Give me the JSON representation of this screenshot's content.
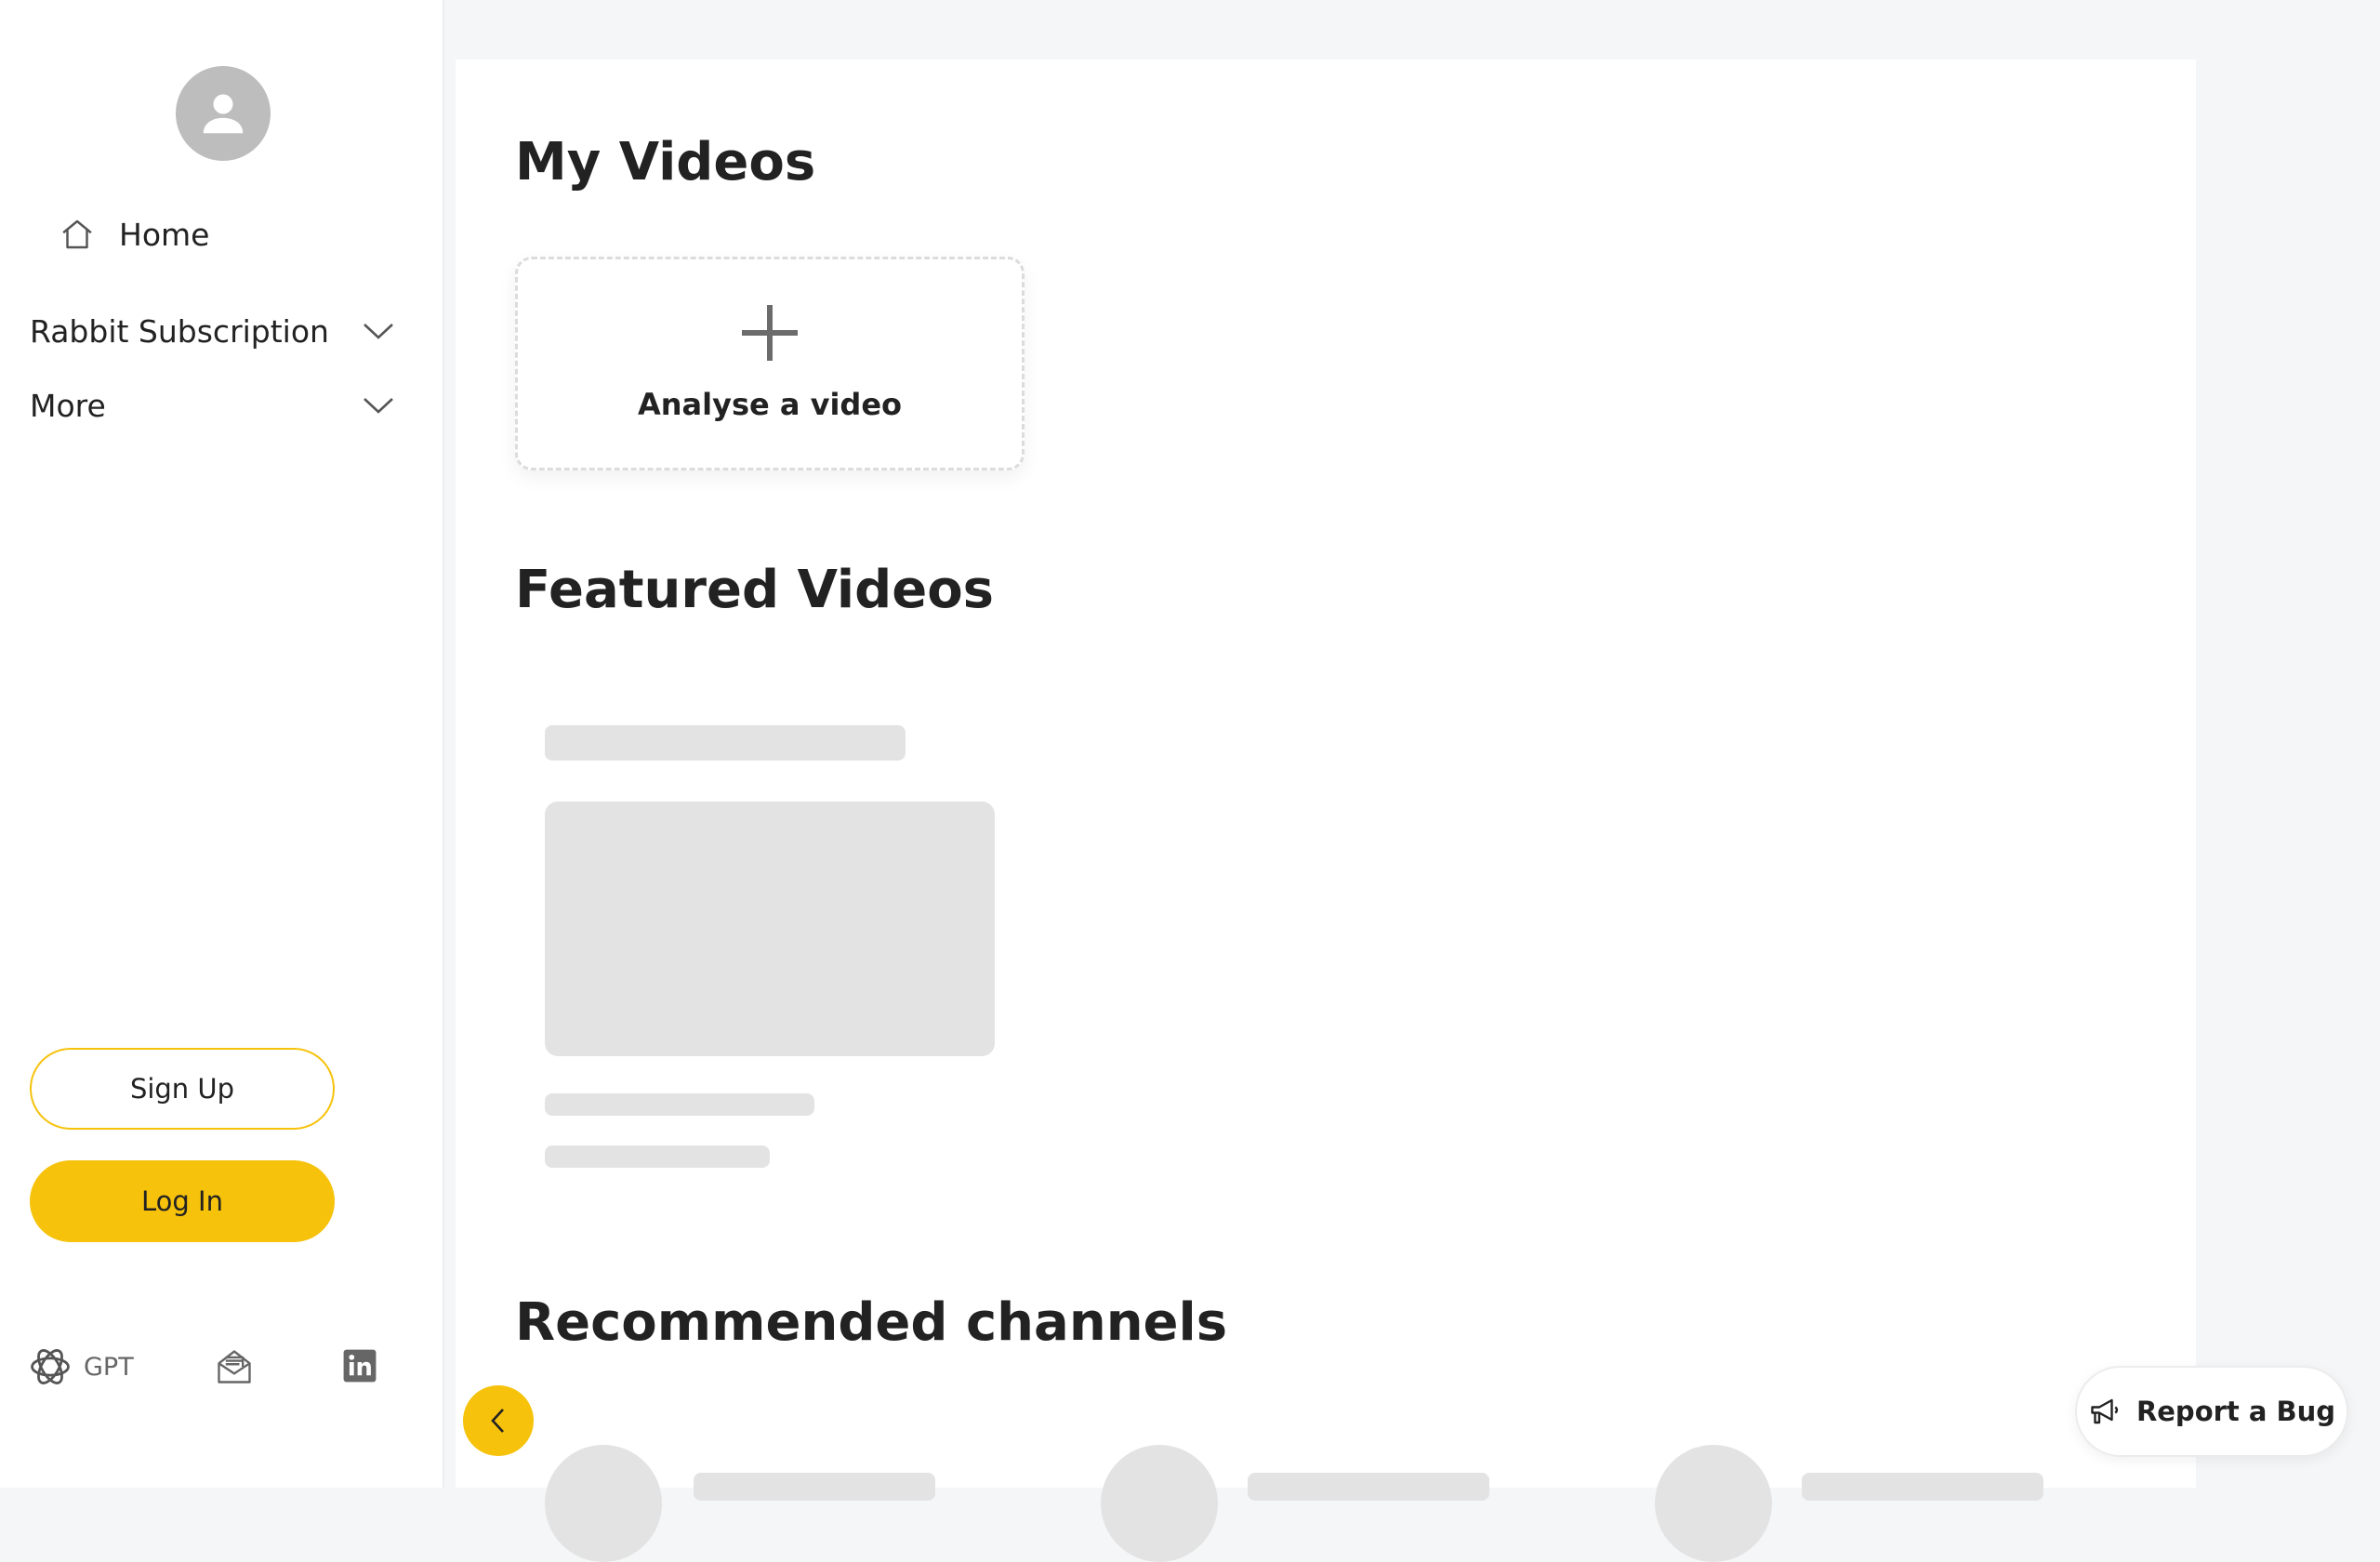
{
  "sidebar": {
    "avatar_icon": "user-avatar-icon",
    "home_label": "Home",
    "groups": [
      {
        "label": "Rabbit Subscription"
      },
      {
        "label": "More"
      }
    ],
    "signup_label": "Sign Up",
    "login_label": "Log In",
    "footer": {
      "gpt_label": "GPT",
      "icons": [
        "openai-icon",
        "mail-icon",
        "linkedin-icon"
      ]
    }
  },
  "main": {
    "my_videos_title": "My Videos",
    "analyse_label": "Analyse a video",
    "featured_title": "Featured Videos",
    "recommended_title": "Recommended channels"
  },
  "report_bug_label": "Report a Bug",
  "colors": {
    "accent": "#f6c20b",
    "skeleton": "#e3e3e3",
    "background": "#f5f6f7"
  }
}
